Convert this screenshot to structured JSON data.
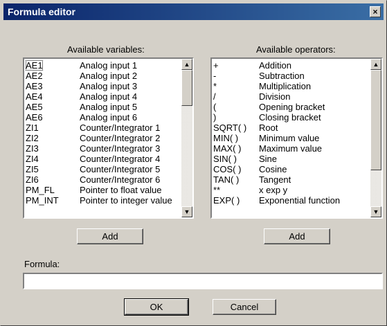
{
  "window": {
    "title": "Formula editor",
    "close_glyph": "×"
  },
  "variables": {
    "heading": "Available variables:",
    "selected_index": 0,
    "items": [
      {
        "name": "AE1",
        "desc": "Analog input 1"
      },
      {
        "name": "AE2",
        "desc": "Analog input 2"
      },
      {
        "name": "AE3",
        "desc": "Analog input 3"
      },
      {
        "name": "AE4",
        "desc": "Analog input 4"
      },
      {
        "name": "AE5",
        "desc": "Analog input 5"
      },
      {
        "name": "AE6",
        "desc": "Analog input 6"
      },
      {
        "name": "ZI1",
        "desc": "Counter/Integrator 1"
      },
      {
        "name": "ZI2",
        "desc": "Counter/Integrator 2"
      },
      {
        "name": "ZI3",
        "desc": "Counter/Integrator 3"
      },
      {
        "name": "ZI4",
        "desc": "Counter/Integrator 4"
      },
      {
        "name": "ZI5",
        "desc": "Counter/Integrator 5"
      },
      {
        "name": "ZI6",
        "desc": "Counter/Integrator 6"
      },
      {
        "name": "PM_FL",
        "desc": "Pointer to float value"
      },
      {
        "name": "PM_INT",
        "desc": "Pointer to integer value"
      }
    ],
    "add_label": "Add"
  },
  "operators": {
    "heading": "Available operators:",
    "items": [
      {
        "symbol": "+",
        "desc": "Addition"
      },
      {
        "symbol": "-",
        "desc": "Subtraction"
      },
      {
        "symbol": "*",
        "desc": "Multiplication"
      },
      {
        "symbol": "/",
        "desc": "Division"
      },
      {
        "symbol": "(",
        "desc": "Opening bracket"
      },
      {
        "symbol": ")",
        "desc": "Closing bracket"
      },
      {
        "symbol": "SQRT( )",
        "desc": "Root"
      },
      {
        "symbol": "MIN( )",
        "desc": "Minimum value"
      },
      {
        "symbol": "MAX( )",
        "desc": "Maximum value"
      },
      {
        "symbol": "SIN( )",
        "desc": "Sine"
      },
      {
        "symbol": "COS( )",
        "desc": "Cosine"
      },
      {
        "symbol": "TAN( )",
        "desc": "Tangent"
      },
      {
        "symbol": "**",
        "desc": "x exp y"
      },
      {
        "symbol": "EXP( )",
        "desc": "Exponential function"
      }
    ],
    "add_label": "Add"
  },
  "formula": {
    "label": "Formula:",
    "value": ""
  },
  "buttons": {
    "ok": "OK",
    "cancel": "Cancel"
  },
  "scroll": {
    "up_glyph": "▲",
    "down_glyph": "▼"
  }
}
